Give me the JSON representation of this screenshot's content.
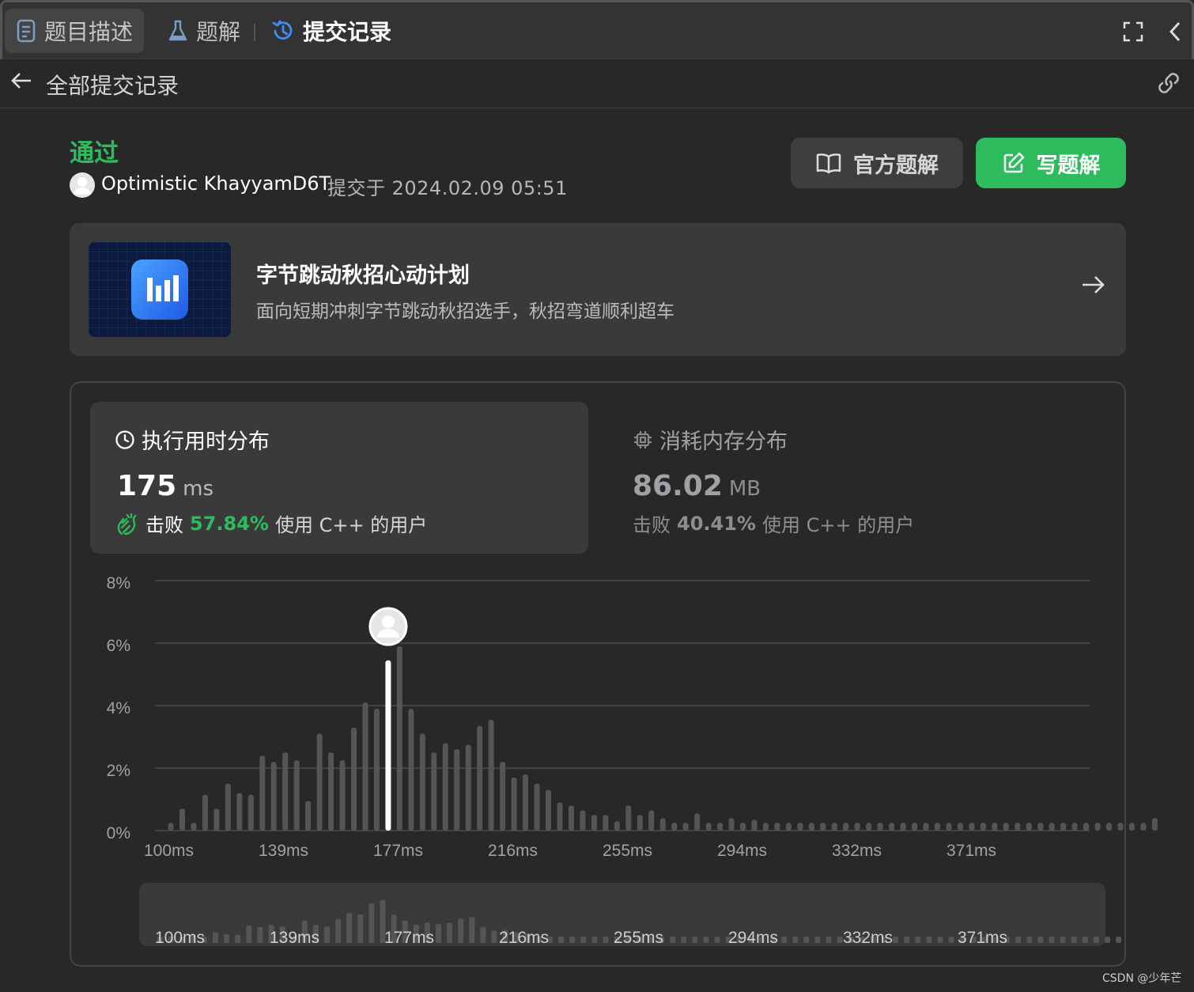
{
  "tabs": [
    {
      "label": "题目描述",
      "icon": "document-icon"
    },
    {
      "label": "题解",
      "icon": "flask-icon"
    },
    {
      "label": "提交记录",
      "icon": "history-icon"
    }
  ],
  "subbar": {
    "title": "全部提交记录"
  },
  "submission": {
    "status": "通过",
    "user": "Optimistic KhayyamD6T",
    "submitted_at": "提交于 2024.02.09 05:51"
  },
  "buttons": {
    "official": "官方题解",
    "write": "写题解"
  },
  "promo": {
    "title": "字节跳动秋招心动计划",
    "desc": "面向短期冲刺字节跳动秋招选手，秋招弯道顺利超车"
  },
  "runtime": {
    "title": "执行用时分布",
    "value": "175",
    "unit": "ms",
    "beat_prefix": "击败",
    "beat_pct": "57.84%",
    "beat_suffix": "使用 C++ 的用户"
  },
  "memory": {
    "title": "消耗内存分布",
    "value": "86.02",
    "unit": "MB",
    "beat_prefix": "击败",
    "beat_pct": "40.41%",
    "beat_suffix": "使用 C++ 的用户"
  },
  "colors": {
    "accent": "#2cbb5d",
    "bar": "#555555",
    "selected": "#ffffff"
  },
  "watermark": "CSDN @少年芒",
  "chart_data": {
    "type": "bar",
    "title": "",
    "xlabel": "",
    "ylabel": "",
    "ylim": [
      0,
      8
    ],
    "y_ticks": [
      "8%",
      "6%",
      "4%",
      "2%",
      "0%"
    ],
    "x_tick_labels": [
      "100ms",
      "139ms",
      "177ms",
      "216ms",
      "255ms",
      "294ms",
      "332ms",
      "371ms"
    ],
    "selected_index": 19,
    "values": [
      0.25,
      0.7,
      0.25,
      1.15,
      0.7,
      1.5,
      1.2,
      1.15,
      2.4,
      2.2,
      2.5,
      2.25,
      0.95,
      3.1,
      2.5,
      2.25,
      3.3,
      4.1,
      3.9,
      5.45,
      5.9,
      3.9,
      3.1,
      2.5,
      2.8,
      2.6,
      2.75,
      3.35,
      3.55,
      2.2,
      1.7,
      1.8,
      1.5,
      1.3,
      0.9,
      0.8,
      0.65,
      0.5,
      0.5,
      0.3,
      0.8,
      0.5,
      0.65,
      0.4,
      0.25,
      0.25,
      0.55,
      0.25,
      0.25,
      0.4,
      0.25,
      0.35,
      0.25,
      0.25,
      0.25,
      0.25,
      0.25,
      0.25,
      0.25,
      0.25,
      0.25,
      0.25,
      0.25,
      0.25,
      0.25,
      0.25,
      0.25,
      0.25,
      0.25,
      0.25,
      0.25,
      0.25,
      0.25,
      0.25,
      0.25,
      0.25,
      0.25,
      0.25,
      0.25,
      0.25,
      0.25,
      0.25,
      0.25,
      0.25,
      0.25,
      0.25,
      0.4
    ]
  }
}
